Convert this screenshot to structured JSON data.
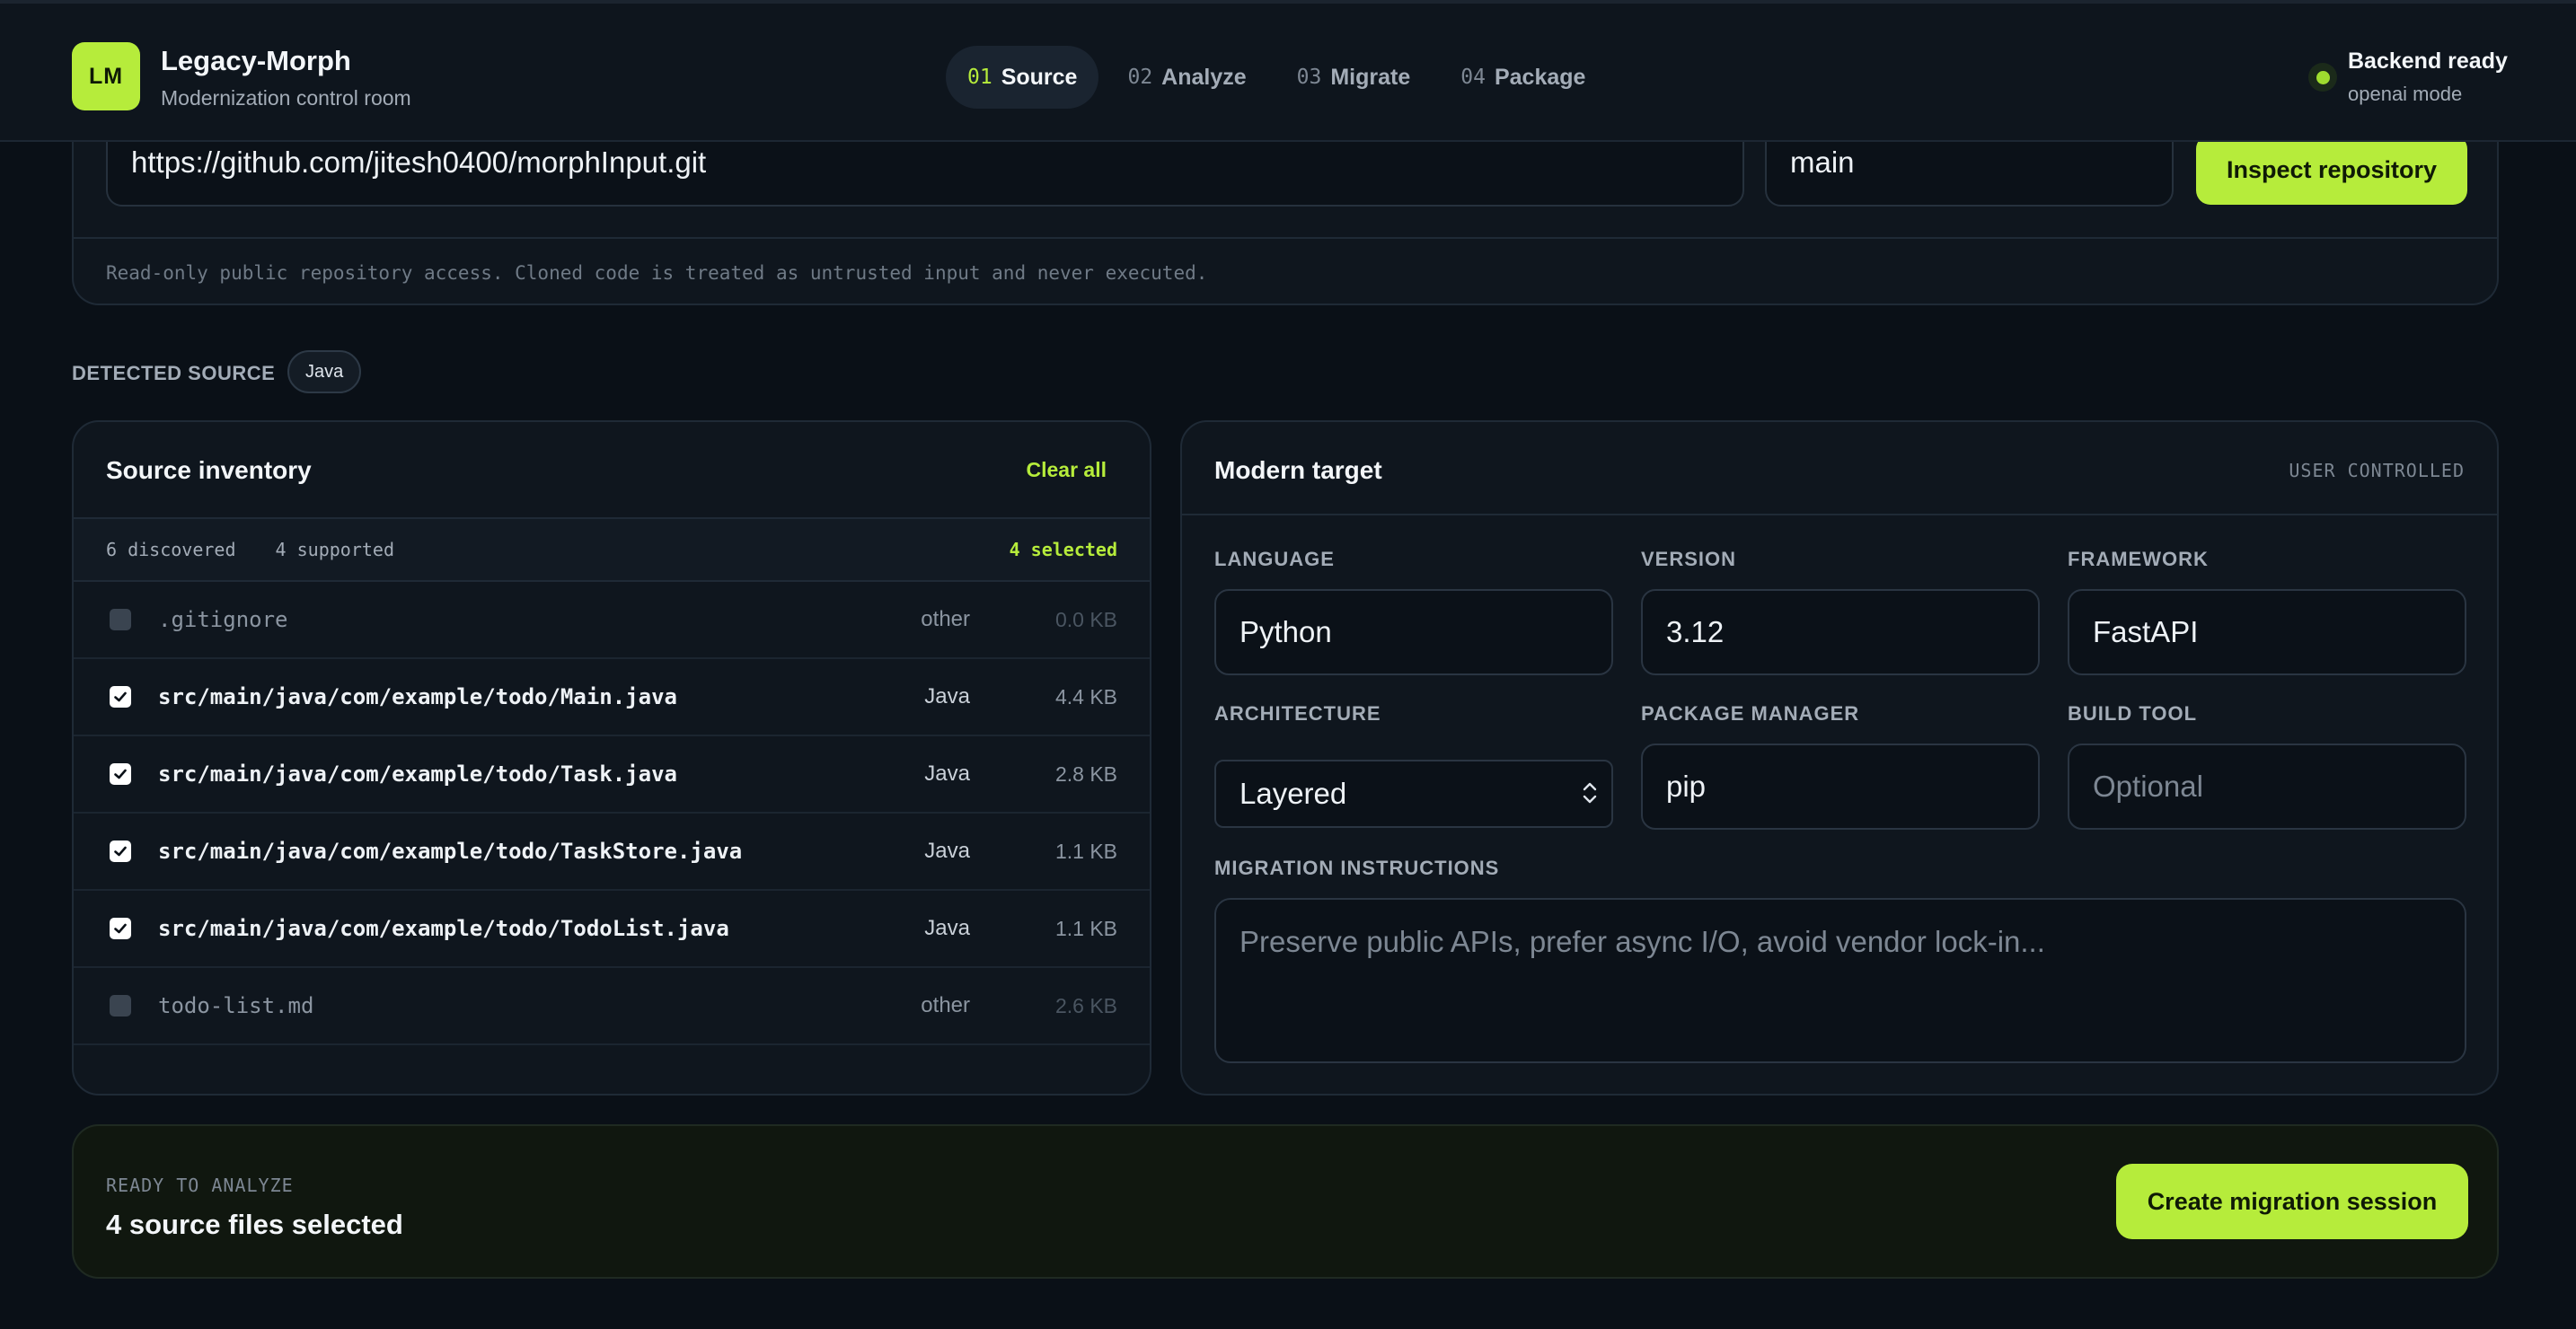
{
  "header": {
    "logo_text": "LM",
    "app_name": "Legacy-Morph",
    "app_subtitle": "Modernization control room",
    "steps": [
      {
        "num": "01",
        "label": "Source",
        "active": true
      },
      {
        "num": "02",
        "label": "Analyze",
        "active": false
      },
      {
        "num": "03",
        "label": "Migrate",
        "active": false
      },
      {
        "num": "04",
        "label": "Package",
        "active": false
      }
    ],
    "status_title": "Backend ready",
    "status_sub": "openai mode"
  },
  "repo": {
    "url": "https://github.com/jitesh0400/morphInput.git",
    "branch": "main",
    "inspect_label": "Inspect repository",
    "note": "Read-only public repository access. Cloned code is treated as untrusted input and never executed."
  },
  "detected": {
    "label": "DETECTED SOURCE",
    "badge": "Java"
  },
  "inventory": {
    "title": "Source inventory",
    "clear_label": "Clear all",
    "discovered": "6 discovered",
    "supported": "4 supported",
    "selected": "4 selected",
    "files": [
      {
        "path": ".gitignore",
        "lang": "other",
        "size": "0.0 KB",
        "checked": false
      },
      {
        "path": "src/main/java/com/example/todo/Main.java",
        "lang": "Java",
        "size": "4.4 KB",
        "checked": true
      },
      {
        "path": "src/main/java/com/example/todo/Task.java",
        "lang": "Java",
        "size": "2.8 KB",
        "checked": true
      },
      {
        "path": "src/main/java/com/example/todo/TaskStore.java",
        "lang": "Java",
        "size": "1.1 KB",
        "checked": true
      },
      {
        "path": "src/main/java/com/example/todo/TodoList.java",
        "lang": "Java",
        "size": "1.1 KB",
        "checked": true
      },
      {
        "path": "todo-list.md",
        "lang": "other",
        "size": "2.6 KB",
        "checked": false
      }
    ]
  },
  "target": {
    "title": "Modern target",
    "tag": "USER CONTROLLED",
    "language_label": "LANGUAGE",
    "language_value": "Python",
    "version_label": "VERSION",
    "version_value": "3.12",
    "framework_label": "FRAMEWORK",
    "framework_value": "FastAPI",
    "architecture_label": "ARCHITECTURE",
    "architecture_value": "Layered",
    "package_manager_label": "PACKAGE MANAGER",
    "package_manager_value": "pip",
    "build_tool_label": "BUILD TOOL",
    "build_tool_placeholder": "Optional",
    "instructions_label": "MIGRATION INSTRUCTIONS",
    "instructions_placeholder": "Preserve public APIs, prefer async I/O, avoid vendor lock-in..."
  },
  "ready": {
    "label": "READY TO ANALYZE",
    "title": "4 source files selected",
    "create_label": "Create migration session"
  },
  "colors": {
    "accent": "#b6ec3b",
    "background": "#0a1017",
    "panel": "#0f161e"
  }
}
